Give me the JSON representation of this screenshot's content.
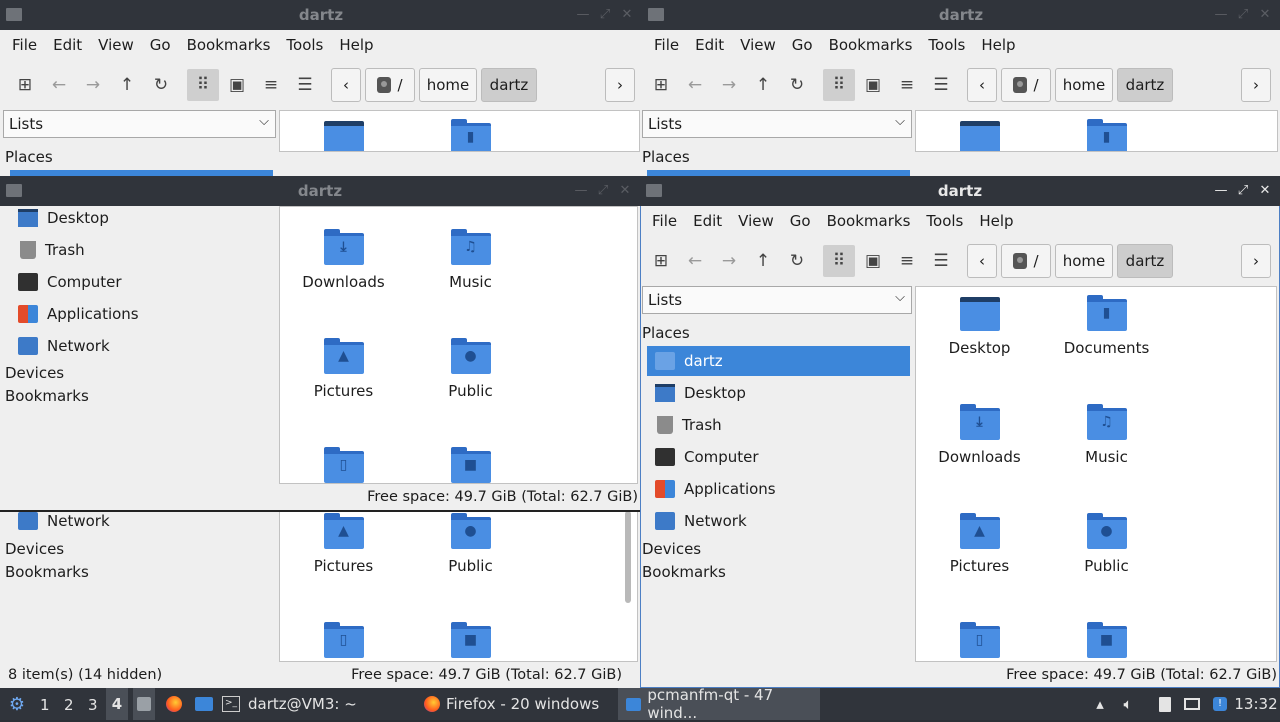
{
  "window_title": "dartz",
  "menu": [
    "File",
    "Edit",
    "View",
    "Go",
    "Bookmarks",
    "Tools",
    "Help"
  ],
  "toolbar_icons": [
    "new-tab-icon",
    "back-arrow-icon",
    "forward-arrow-icon",
    "up-arrow-icon",
    "reload-icon",
    "icon-view-icon",
    "thumbnail-view-icon",
    "compact-view-icon",
    "detailed-list-icon"
  ],
  "path": {
    "root": "/",
    "segments": [
      "home",
      "dartz"
    ]
  },
  "side_combo": "Lists",
  "places_header": "Places",
  "devices_header": "Devices",
  "bookmarks_header": "Bookmarks",
  "places": [
    "dartz",
    "Desktop",
    "Trash",
    "Computer",
    "Applications",
    "Network"
  ],
  "files": [
    "Desktop",
    "Documents",
    "Downloads",
    "Music",
    "Pictures",
    "Public"
  ],
  "status_items": "8 item(s) (14 hidden)",
  "status_free": "Free space: 49.7 GiB (Total: 62.7 GiB)",
  "taskbar": {
    "workspaces": [
      "1",
      "2",
      "3",
      "4"
    ],
    "active_workspace": "4",
    "terminal": "dartz@VM3: ~",
    "firefox": "Firefox - 20 windows",
    "pcmanfm": "pcmanfm-qt - 47 wind...",
    "clock": "13:32"
  },
  "colors": {
    "accent": "#3c86d9",
    "titlebar": "#30343b",
    "folder": "#4a8ee3"
  }
}
